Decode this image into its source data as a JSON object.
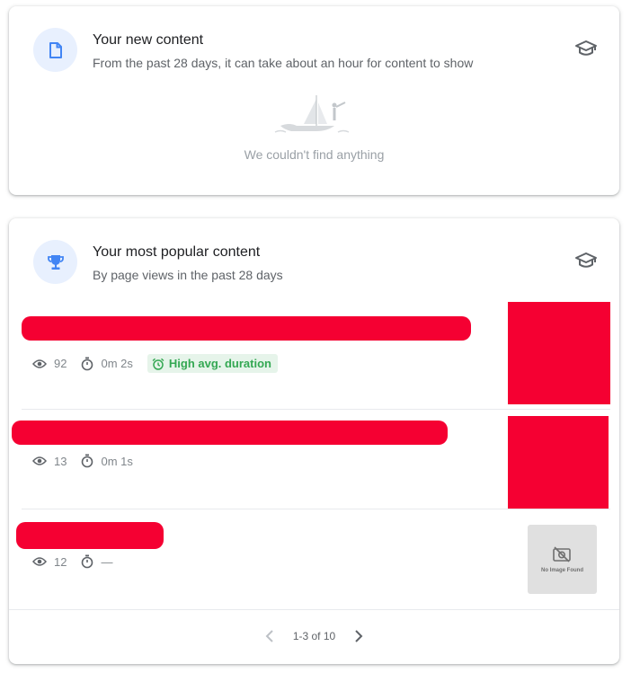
{
  "new_content": {
    "title": "Your new content",
    "subtitle": "From the past 28 days, it can take about an hour for content to show",
    "empty_message": "We couldn't find anything",
    "icon": "document-icon"
  },
  "popular_content": {
    "title": "Your most popular content",
    "subtitle": "By page views in the past 28 days",
    "icon": "trophy-icon",
    "items": [
      {
        "views": "92",
        "duration": "0m 2s",
        "badge": "High avg. duration"
      },
      {
        "views": "13",
        "duration": "0m 1s"
      },
      {
        "views": "12",
        "duration": "—",
        "thumbnail_text": "No Image Found"
      }
    ],
    "pagination": {
      "label": "1-3 of 10"
    }
  },
  "colors": {
    "accent_blue": "#4285f4",
    "icon_bg": "#e8f0fe",
    "badge_green": "#34a853",
    "redaction": "#f50032"
  }
}
